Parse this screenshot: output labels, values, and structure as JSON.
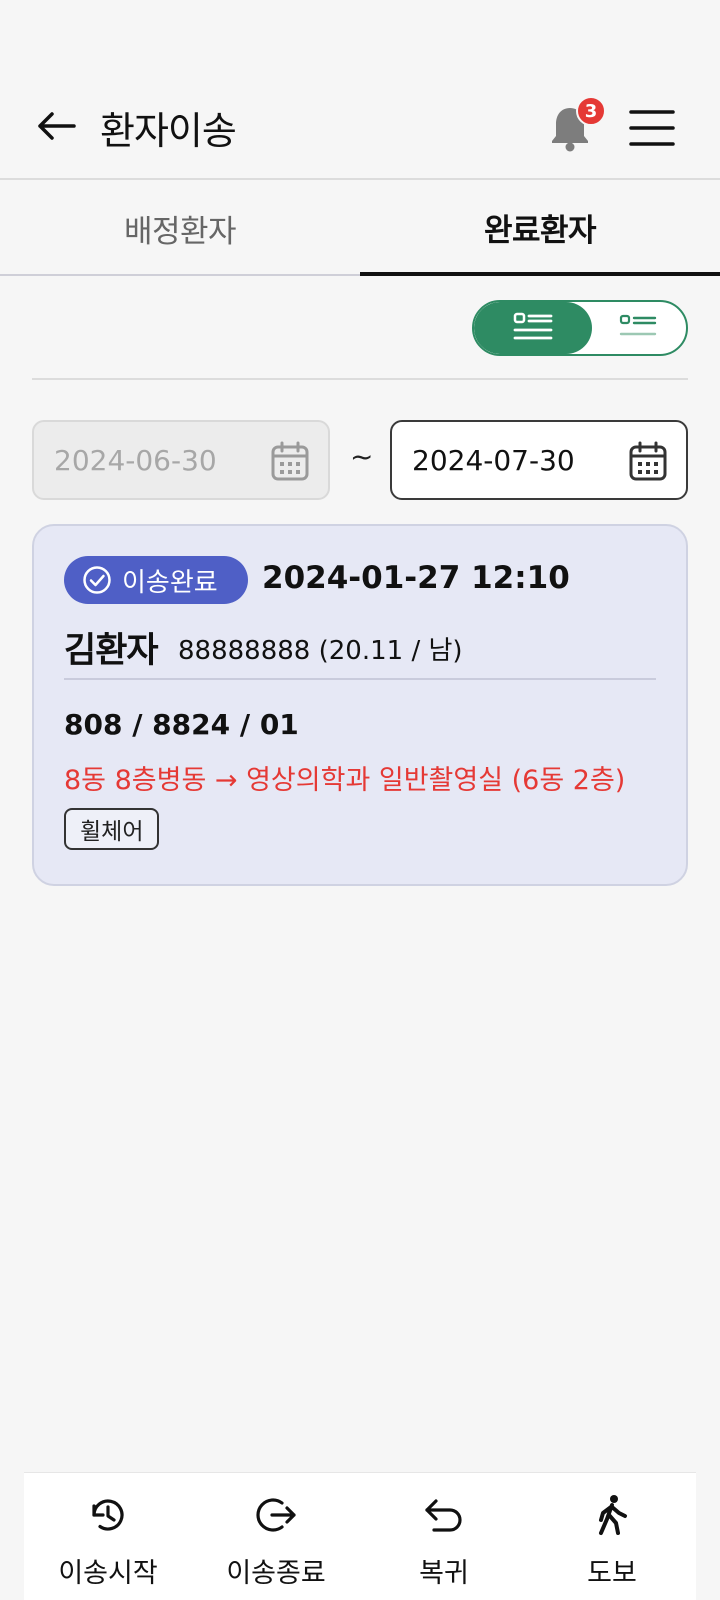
{
  "header": {
    "title": "환자이송",
    "notification_count": "3"
  },
  "tabs": [
    {
      "label": "배정환자",
      "active": false
    },
    {
      "label": "완료환자",
      "active": true
    }
  ],
  "view_toggle": {
    "selected": "list-detailed"
  },
  "date_range": {
    "from": "2024-06-30",
    "separator": "~",
    "to": "2024-07-30"
  },
  "records": [
    {
      "status": "이송완료",
      "datetime": "2024-01-27 12:10",
      "patient_name": "김환자",
      "patient_info": "88888888 (20.11 / 남)",
      "room": "808 / 8824 / 01",
      "route": "8동 8층병동 → 영상의학과 일반촬영실 (6동 2층)",
      "tag": "휠체어"
    }
  ],
  "bottom_nav": [
    {
      "label": "이송시작",
      "icon": "transfer-start-icon"
    },
    {
      "label": "이송종료",
      "icon": "transfer-end-icon"
    },
    {
      "label": "복귀",
      "icon": "return-icon"
    },
    {
      "label": "도보",
      "icon": "walk-icon"
    }
  ],
  "colors": {
    "accent_green": "#2e8b63",
    "status_blue": "#4f5fc6",
    "route_red": "#e53935",
    "card_bg": "#e6e8f5"
  }
}
